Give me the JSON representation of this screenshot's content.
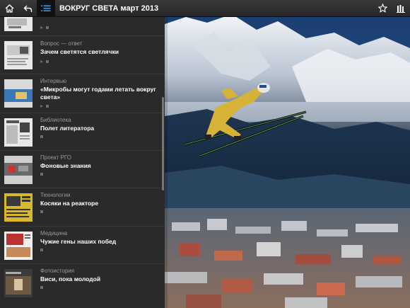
{
  "topbar": {
    "title": "ВОКРУГ СВЕТА март 2013",
    "icons": [
      "home-icon",
      "back-icon",
      "table-of-contents-icon",
      "star-icon",
      "library-icon"
    ]
  },
  "toc": {
    "items": [
      {
        "section": "",
        "title": ""
      },
      {
        "section": "Вопрос — ответ",
        "title": "Зачем светятся светлячки"
      },
      {
        "section": "Интервью",
        "title": "«Микробы могут годами летать вокруг света»"
      },
      {
        "section": "Библиотека",
        "title": "Полет литератора"
      },
      {
        "section": "Проект РГО",
        "title": "Фоновые знания"
      },
      {
        "section": "Технологии",
        "title": "Косяки на реакторе"
      },
      {
        "section": "Медицина",
        "title": "Чужие гены наших побед"
      },
      {
        "section": "Фотоистория",
        "title": "Виси, пока молодой"
      }
    ]
  },
  "colors": {
    "sky": "#1f3f70",
    "jumper_suit": "#d6b236"
  }
}
